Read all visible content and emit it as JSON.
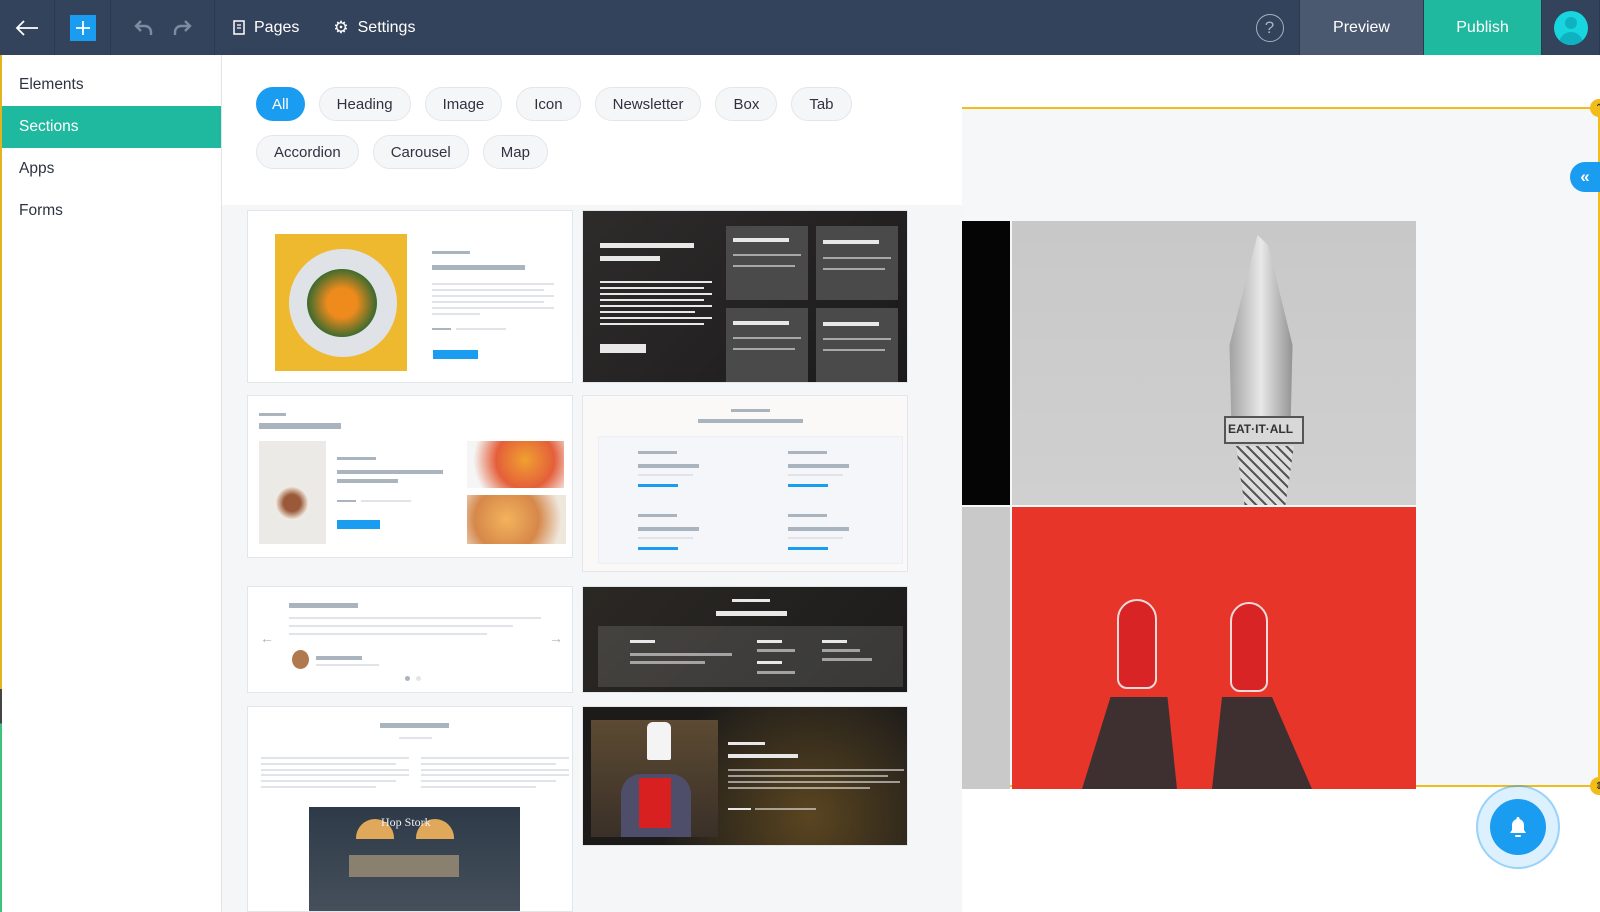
{
  "topbar": {
    "back_icon": "arrow-left-icon",
    "add_icon": "plus-icon",
    "undo_icon": "undo-icon",
    "redo_icon": "redo-icon",
    "pages_label": "Pages",
    "settings_label": "Settings",
    "help_label": "?",
    "preview_label": "Preview",
    "publish_label": "Publish",
    "avatar_icon": "user-avatar-icon"
  },
  "sidebar": {
    "items": [
      {
        "label": "Elements",
        "active": false
      },
      {
        "label": "Sections",
        "active": true
      },
      {
        "label": "Apps",
        "active": false
      },
      {
        "label": "Forms",
        "active": false
      }
    ]
  },
  "filters": {
    "row1": [
      "All",
      "Heading",
      "Image",
      "Icon",
      "Newsletter",
      "Box",
      "Tab"
    ],
    "row2": [
      "Accordion",
      "Carousel",
      "Map"
    ],
    "active": "All"
  },
  "templates": [
    {
      "name": "image-text-section",
      "theme": "light"
    },
    {
      "name": "dark-features-grid",
      "theme": "dark"
    },
    {
      "name": "gallery-text-section",
      "theme": "light"
    },
    {
      "name": "four-box-section",
      "theme": "light"
    },
    {
      "name": "testimonial-carousel",
      "theme": "light"
    },
    {
      "name": "dark-menu-section",
      "theme": "dark"
    },
    {
      "name": "two-column-text-image",
      "theme": "light",
      "image_text": "Hop Stork"
    },
    {
      "name": "chef-feature-section",
      "theme": "dark"
    }
  ],
  "canvas": {
    "image_text": "EAT·IT·ALL",
    "collapse_label": "«",
    "colors": {
      "accent": "#1a9cf1",
      "teal": "#1fb99f",
      "selection": "#f2bd1b",
      "topbar": "#34435c"
    }
  }
}
